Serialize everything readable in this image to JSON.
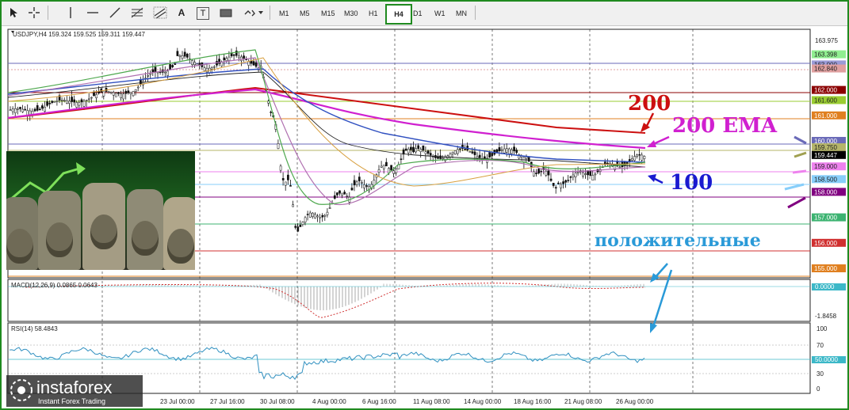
{
  "toolbar": {
    "icons": [
      "cursor-icon",
      "crosshair-icon",
      "vertical-line-icon",
      "horizontal-line-icon",
      "trendline-icon",
      "fibonacci-icon",
      "channel-icon",
      "text-icon",
      "label-icon",
      "rectangle-icon",
      "arrows-icon"
    ],
    "text_tool": "A",
    "label_tool": "T",
    "timeframes": [
      "M1",
      "M5",
      "M15",
      "M30",
      "H1",
      "H4",
      "D1",
      "W1",
      "MN"
    ],
    "active_timeframe": "H4"
  },
  "chart": {
    "symbol_info": "USDJPY,H4  159.324 159.525 159.311 159.447",
    "price_labels": [
      "163.975",
      "163.000",
      "162.000",
      "161.000",
      "160.000",
      "159.000",
      "158.000",
      "157.000",
      "156.000",
      "155.000"
    ],
    "colored_price_tags": [
      {
        "text": "163.398",
        "color": "#90ee90"
      },
      {
        "text": "163.000",
        "color": "#9b9bd6"
      },
      {
        "text": "162.840",
        "color": "#e0a0a0"
      },
      {
        "text": "162.000",
        "color": "#8b0000"
      },
      {
        "text": "161.600",
        "color": "#9acd32"
      },
      {
        "text": "161.000",
        "color": "#e08020"
      },
      {
        "text": "160.000",
        "color": "#6a6ab8"
      },
      {
        "text": "159.750",
        "color": "#b5b56a"
      },
      {
        "text": "159.447",
        "color": "#000000"
      },
      {
        "text": "159.000",
        "color": "#ee82ee"
      },
      {
        "text": "158.500",
        "color": "#87cefa"
      },
      {
        "text": "158.000",
        "color": "#800080"
      },
      {
        "text": "157.000",
        "color": "#3cb371"
      },
      {
        "text": "156.000",
        "color": "#d03030"
      },
      {
        "text": "155.000",
        "color": "#e08020"
      }
    ],
    "time_labels": [
      "23 Jul 00:00",
      "27 Jul 16:00",
      "30 Jul 08:00",
      "4 Aug 00:00",
      "6 Aug 16:00",
      "11 Aug 08:00",
      "14 Aug 00:00",
      "18 Aug 16:00",
      "21 Aug 08:00",
      "26 Aug 00:00"
    ],
    "annotations": {
      "label_200": "200",
      "label_200_ema": "200 EMA",
      "label_100": "100",
      "label_positive": "положительные"
    }
  },
  "macd": {
    "label": "MACD(12,26,9) 0.0865 0.0643",
    "scale_top": "0.0000",
    "scale_bottom": "-1.8458"
  },
  "rsi": {
    "label": "RSI(14) 58.4843",
    "levels": [
      "100",
      "70",
      "50.0000",
      "30",
      "0"
    ]
  },
  "branding": {
    "name": "instaforex",
    "tagline": "Instant Forex Trading"
  },
  "colors": {
    "frame": "#1f8a1f",
    "ema200": "#cc1010",
    "ema200_magenta": "#d020d0",
    "ema100": "#1a1ad0",
    "positive": "#2a9ad8"
  }
}
